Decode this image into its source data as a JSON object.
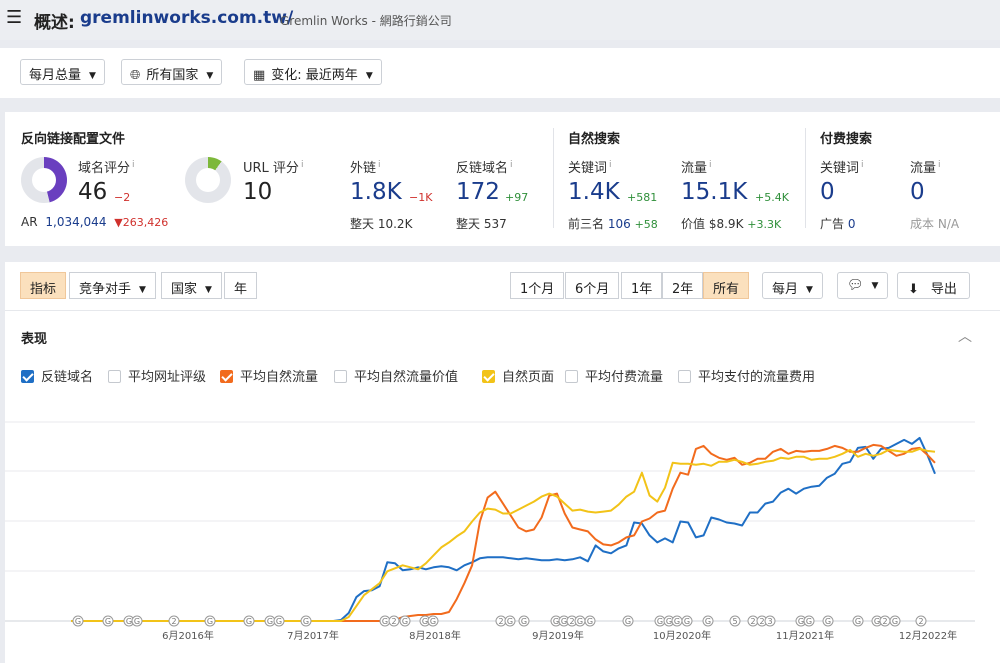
{
  "header": {
    "title_prefix": "概述:",
    "domain": "gremlinworks.com.tw/",
    "company": "Gremlin Works - 網路行銷公司"
  },
  "filters": {
    "volume": "每月总量",
    "country": "所有国家",
    "change": "变化: 最近两年"
  },
  "backlink_profile": {
    "title": "反向链接配置文件",
    "domain_rating": {
      "label": "域名评分",
      "value": "46",
      "delta": "−2",
      "fill_fraction": 0.46
    },
    "url_rating": {
      "label": "URL 评分",
      "value": "10",
      "fill_fraction": 0.1
    },
    "ar_label": "AR",
    "ar_value": "1,034,044",
    "ar_delta": "263,426",
    "backlinks": {
      "label": "外链",
      "value": "1.8K",
      "delta": "−1K",
      "sub_label": "整天",
      "sub_value": "10.2K"
    },
    "ref_domains": {
      "label": "反链域名",
      "value": "172",
      "delta": "+97",
      "sub_label": "整天",
      "sub_value": "537"
    }
  },
  "organic": {
    "title": "自然搜索",
    "keywords": {
      "label": "关键词",
      "value": "1.4K",
      "delta": "+581",
      "sub_label": "前三名",
      "sub_value": "106",
      "sub_delta": "+58"
    },
    "traffic": {
      "label": "流量",
      "value": "15.1K",
      "delta": "+5.4K",
      "sub_label": "价值",
      "sub_value": "$8.9K",
      "sub_delta": "+3.3K"
    }
  },
  "paid": {
    "title": "付费搜索",
    "keywords": {
      "label": "关键词",
      "value": "0",
      "sub_label": "广告",
      "sub_value": "0"
    },
    "traffic": {
      "label": "流量",
      "value": "0",
      "sub_label": "成本",
      "sub_value": "N/A"
    }
  },
  "panel": {
    "tabs": [
      "指标",
      "竞争对手",
      "国家",
      "年"
    ],
    "ranges": [
      "1个月",
      "6个月",
      "1年",
      "2年",
      "所有"
    ],
    "active_range": "所有",
    "interval": "每月",
    "export": "导出",
    "section_title": "表现",
    "legend": [
      {
        "label": "反链域名",
        "checked": true,
        "color": "#1f6fc5"
      },
      {
        "label": "平均网址评级",
        "checked": false
      },
      {
        "label": "平均自然流量",
        "checked": true,
        "color": "#f26b1d"
      },
      {
        "label": "平均自然流量价值",
        "checked": false
      },
      {
        "label": "自然页面",
        "checked": true,
        "color": "#f2c318"
      },
      {
        "label": "平均付费流量",
        "checked": false
      },
      {
        "label": "平均支付的流量费用",
        "checked": false
      }
    ]
  },
  "chart_data": {
    "type": "line",
    "x_tick_labels": [
      "6月2016年",
      "7月2017年",
      "8月2018年",
      "9月2019年",
      "10月2020年",
      "11月2021年",
      "12月2022年"
    ],
    "y_scale": "normalized 0-100 per series, no printed ticks",
    "grid": true,
    "series": [
      {
        "name": "反链域名",
        "color": "#1f6fc5",
        "values": [
          0,
          0,
          0,
          0,
          0,
          0,
          0,
          0,
          0,
          0,
          0,
          0,
          0,
          0,
          0,
          0,
          0,
          0,
          0,
          0,
          0,
          0,
          0,
          0,
          0,
          0,
          0,
          0,
          0,
          0,
          0,
          0,
          0,
          0,
          0,
          1,
          8,
          24,
          30,
          31,
          35,
          59,
          58,
          51,
          52,
          54,
          52,
          54,
          55,
          54,
          51,
          56,
          59,
          63,
          64,
          64,
          64,
          63,
          62,
          63,
          62,
          61,
          61,
          62,
          61,
          62,
          64,
          60,
          76,
          70,
          68,
          73,
          76,
          99,
          98,
          86,
          79,
          83,
          79,
          100,
          99,
          84,
          86,
          104,
          102,
          99,
          98,
          96,
          109,
          109,
          118,
          120,
          129,
          133,
          128,
          133,
          135,
          136,
          144,
          148,
          158,
          160,
          174,
          175,
          163,
          173,
          174,
          178,
          182,
          178,
          184,
          167,
          148
        ]
      },
      {
        "name": "平均自然流量",
        "color": "#f26b1d",
        "values": [
          0,
          0,
          0,
          0,
          0,
          0,
          0,
          0,
          0,
          0,
          0,
          0,
          0,
          0,
          0,
          0,
          0,
          0,
          0,
          0,
          0,
          0,
          0,
          0,
          0,
          0,
          0,
          0,
          0,
          0,
          0,
          0,
          0,
          0,
          0,
          0,
          0,
          0,
          0,
          0,
          0,
          0,
          1,
          4,
          5,
          6,
          6,
          7,
          7,
          9,
          22,
          38,
          56,
          100,
          124,
          130,
          118,
          106,
          94,
          90,
          92,
          104,
          126,
          128,
          108,
          94,
          92,
          90,
          82,
          77,
          76,
          79,
          84,
          86,
          100,
          103,
          109,
          111,
          133,
          149,
          147,
          173,
          176,
          168,
          164,
          162,
          164,
          157,
          159,
          163,
          163,
          170,
          173,
          168,
          171,
          170,
          171,
          171,
          173,
          176,
          174,
          170,
          170,
          174,
          177,
          176,
          171,
          166,
          168,
          173,
          174,
          167,
          159
        ]
      },
      {
        "name": "自然页面",
        "color": "#f2c318",
        "values": [
          0,
          0,
          0,
          0,
          0,
          0,
          0,
          0,
          0,
          0,
          0,
          0,
          0,
          0,
          0,
          0,
          0,
          0,
          0,
          0,
          0,
          0,
          0,
          0,
          0,
          0,
          0,
          0,
          0,
          0,
          0,
          0,
          0,
          0,
          0,
          0,
          4,
          15,
          26,
          32,
          38,
          50,
          53,
          56,
          54,
          52,
          58,
          66,
          74,
          79,
          85,
          90,
          100,
          109,
          113,
          112,
          108,
          108,
          112,
          116,
          120,
          125,
          128,
          125,
          118,
          111,
          112,
          110,
          109,
          110,
          111,
          117,
          125,
          130,
          149,
          126,
          120,
          134,
          159,
          158,
          158,
          157,
          158,
          156,
          160,
          160,
          162,
          160,
          157,
          158,
          160,
          161,
          164,
          163,
          165,
          165,
          162,
          163,
          163,
          165,
          168,
          172,
          165,
          168,
          166,
          168,
          172,
          171,
          170,
          170,
          173,
          171,
          170
        ]
      }
    ],
    "y_max_display": 200
  },
  "timeline_markers": [
    "G",
    "G",
    "G",
    "G",
    "2",
    "G",
    "G",
    "G",
    "G",
    "G",
    "G",
    "2",
    "G",
    "G",
    "G",
    "2",
    "G",
    "G",
    "G",
    "G",
    "2",
    "G",
    "G",
    "G",
    "G",
    "G",
    "G",
    "G",
    "G",
    "5",
    "2",
    "2",
    "3",
    "G",
    "G",
    "G",
    "G",
    "G",
    "2",
    "G",
    "2"
  ]
}
